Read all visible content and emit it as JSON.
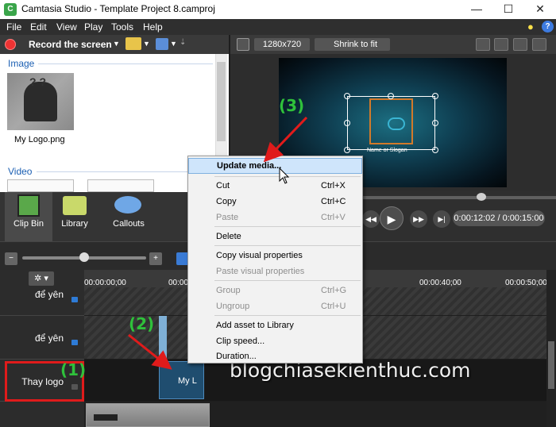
{
  "window": {
    "title": "Camtasia Studio - Template Project 8.camproj",
    "app_icon": "C",
    "min": "—",
    "max": "☐",
    "close": "✕"
  },
  "menu": [
    "File",
    "Edit",
    "View",
    "Play",
    "Tools",
    "Help"
  ],
  "toolbar": {
    "record_label": "Record the screen",
    "caret": "▼",
    "more": "⇣"
  },
  "clip_bin": {
    "image_heading": "Image",
    "image_item_name": "My Logo.png",
    "video_heading": "Video"
  },
  "tabs": [
    "Clip Bin",
    "Library",
    "Callouts"
  ],
  "preview": {
    "dimensions": "1280x720",
    "fit": "Shrink to fit",
    "logo_caption": "Name or Slogan"
  },
  "playback": {
    "timecode": "0:00:12:02 / 0:00:15:00"
  },
  "timeline": {
    "ticks": [
      "00:00:00;00",
      "00:00:10",
      "00:00:40;00",
      "00:00:50;00"
    ],
    "tracks": [
      "để yên",
      "để yên",
      "Thay logo"
    ],
    "logo_clip_label": "My L"
  },
  "context_menu": {
    "update_media": "Update media...",
    "cut": "Cut",
    "cut_sc": "Ctrl+X",
    "copy": "Copy",
    "copy_sc": "Ctrl+C",
    "paste": "Paste",
    "paste_sc": "Ctrl+V",
    "delete": "Delete",
    "copy_visual": "Copy visual properties",
    "paste_visual": "Paste visual properties",
    "group": "Group",
    "group_sc": "Ctrl+G",
    "ungroup": "Ungroup",
    "ungroup_sc": "Ctrl+U",
    "add_library": "Add asset to Library",
    "clip_speed": "Clip speed...",
    "duration": "Duration..."
  },
  "annotations": {
    "a1": "(1)",
    "a2": "(2)",
    "a3": "(3)",
    "color": "#2fc13b",
    "arrow_color": "#e01b1b"
  },
  "watermark": "blogchiasekienthuc.com",
  "icons": [
    "record-icon",
    "folder-icon",
    "export-icon",
    "lightbulb-icon",
    "help-icon",
    "zoom-out-icon",
    "zoom-in-icon",
    "gear-icon",
    "lock-icon",
    "play-icon"
  ]
}
